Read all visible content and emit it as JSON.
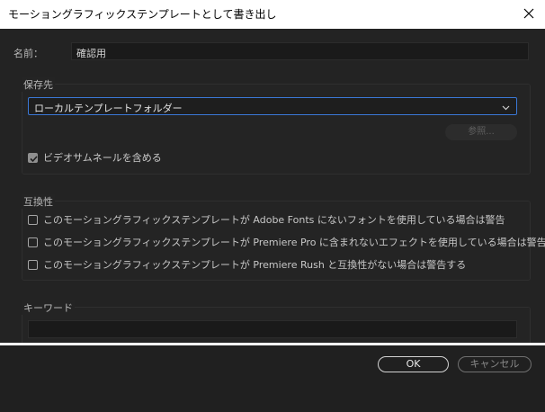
{
  "window": {
    "title": "モーショングラフィックステンプレートとして書き出し",
    "close_icon": "close-icon"
  },
  "name_field": {
    "label": "名前：",
    "value": "確認用"
  },
  "destination": {
    "group_title": "保存先",
    "dropdown_value": "ローカルテンプレートフォルダー",
    "browse_label": "参照...",
    "video_thumbnail_label": "ビデオサムネールを含める",
    "video_thumbnail_checked": true
  },
  "compatibility": {
    "group_title": "互換性",
    "options": [
      {
        "label": "このモーショングラフィックステンプレートが Adobe Fonts にないフォントを使用している場合は警告",
        "checked": false
      },
      {
        "label": "このモーショングラフィックステンプレートが Premiere Pro に含まれないエフェクトを使用している場合は警告",
        "checked": false
      },
      {
        "label": "このモーショングラフィックステンプレートが Premiere Rush と互換性がない場合は警告する",
        "checked": false
      }
    ]
  },
  "keywords": {
    "group_title": "キーワード",
    "value": ""
  },
  "footer": {
    "ok_label": "OK",
    "cancel_label": "キャンセル"
  },
  "colors": {
    "accent_border": "#3a78d6",
    "background": "#232323"
  }
}
